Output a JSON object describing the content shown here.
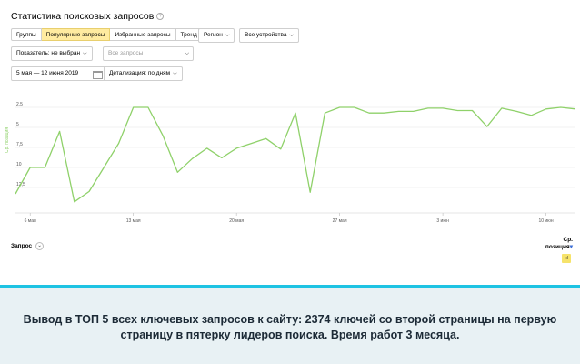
{
  "header": {
    "title": "Статистика поисковых запросов"
  },
  "tabs": [
    {
      "label": "Группы",
      "active": false
    },
    {
      "label": "Популярные запросы",
      "active": true
    },
    {
      "label": "Избранные запросы",
      "active": false
    },
    {
      "label": "Тренд",
      "active": false
    }
  ],
  "filters": {
    "region_label": "Регион",
    "devices_label": "Все устройства",
    "indicator_label": "Показатель: не выбран",
    "queries_placeholder": "Все запросы",
    "date_range": "5 мая — 12 июня 2019",
    "detail_label": "Детализация: по дням"
  },
  "table": {
    "query_header": "Запрос",
    "position_header_line1": "Ср.",
    "position_header_line2": "позиция",
    "sort_arrow": "▾"
  },
  "footer": {
    "caption": "Вывод в ТОП 5 всех ключевых запросов к сайту: 2374 ключей со второй страницы на первую страницу в пятерку лидеров поиска. Время работ 3 месяца."
  },
  "colors": {
    "line": "#8fd16a",
    "active_tab": "#ffeba0",
    "divider": "#1ec3e3",
    "footer_bg": "#e8f1f4"
  },
  "chart_data": {
    "type": "line",
    "ylabel": "Ср. позиция",
    "y_inverted": true,
    "y_ticks": [
      "2,5",
      "5",
      "7,5",
      "10",
      "12,5"
    ],
    "y_tick_values": [
      2.5,
      5,
      7.5,
      10,
      12.5
    ],
    "ylim": [
      0,
      15
    ],
    "x_ticks": [
      "6 мая",
      "13 мая",
      "20 мая",
      "27 мая",
      "3 июн",
      "10 июн"
    ],
    "x_tick_days": [
      1,
      8,
      15,
      22,
      29,
      36
    ],
    "series": [
      {
        "values": [
          13.3,
          10.0,
          10.0,
          5.5,
          14.3,
          13.0,
          10.0,
          7.0,
          2.5,
          2.5,
          6.0,
          10.6,
          8.9,
          7.6,
          8.8,
          7.6,
          7.0,
          6.4,
          7.7,
          3.2,
          13.1,
          3.2,
          2.5,
          2.5,
          3.2,
          3.2,
          3.0,
          3.0,
          2.6,
          2.6,
          2.9,
          2.9,
          4.9,
          2.6,
          3.0,
          3.5,
          2.7,
          2.5,
          2.7
        ]
      }
    ]
  }
}
